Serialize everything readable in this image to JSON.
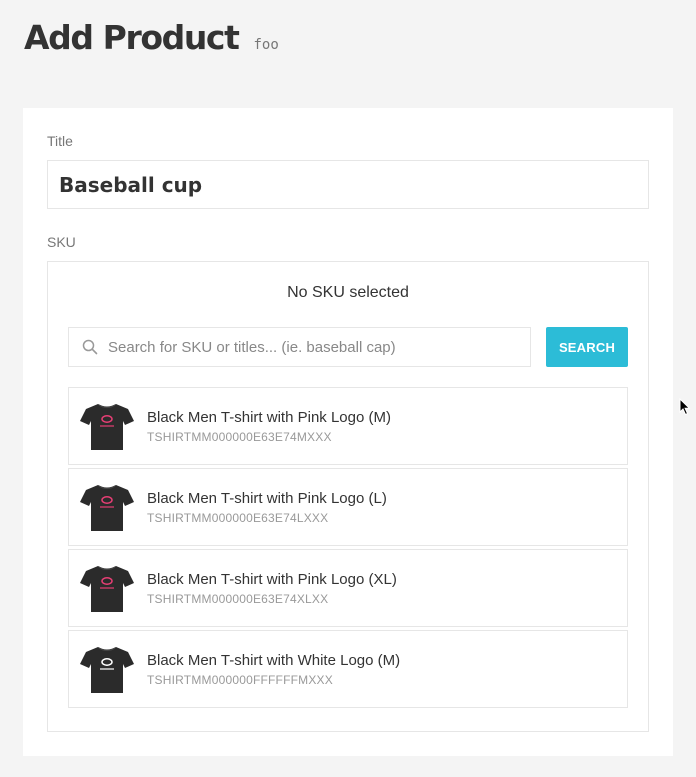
{
  "header": {
    "title": "Add Product",
    "subtitle": "foo"
  },
  "form": {
    "title_label": "Title",
    "title_value": "Baseball cup",
    "sku_label": "SKU",
    "sku_status": "No SKU selected",
    "search_placeholder": "Search for SKU or titles... (ie. baseball cap)",
    "search_button_label": "SEARCH"
  },
  "sku_results": [
    {
      "name": "Black Men T-shirt with Pink Logo (M)",
      "code": "TSHIRTMM000000E63E74MXXX",
      "logo": "pink"
    },
    {
      "name": "Black Men T-shirt with Pink Logo (L)",
      "code": "TSHIRTMM000000E63E74LXXX",
      "logo": "pink"
    },
    {
      "name": "Black Men T-shirt with Pink Logo (XL)",
      "code": "TSHIRTMM000000E63E74XLXX",
      "logo": "pink"
    },
    {
      "name": "Black Men T-shirt with White Logo (M)",
      "code": "TSHIRTMM000000FFFFFFMXXX",
      "logo": "white"
    }
  ],
  "colors": {
    "accent": "#2cbcd7",
    "background": "#f4f4f4",
    "card": "#ffffff",
    "shirt": "#2b2b2b",
    "logo_pink": "#e63e74",
    "logo_white": "#ffffff"
  },
  "icons": {
    "search": "search-icon",
    "thumbnail": "tshirt-icon",
    "cursor": "mouse-pointer-icon"
  }
}
